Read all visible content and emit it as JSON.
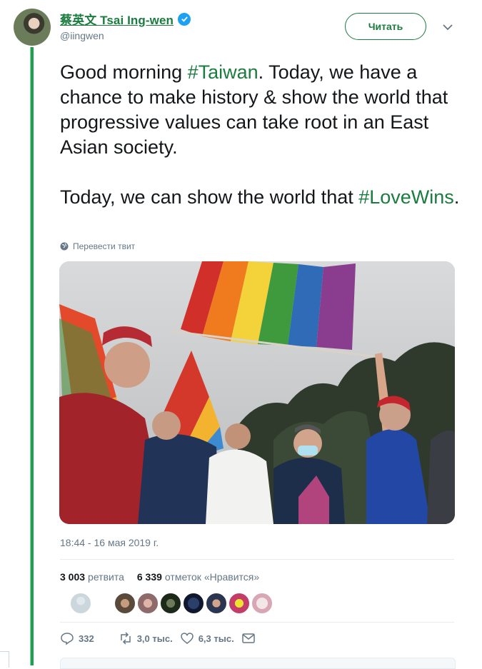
{
  "user": {
    "display_name": "蔡英文 Tsai Ing-wen",
    "handle": "@iingwen",
    "verified": true
  },
  "follow_label": "Читать",
  "tweet": {
    "paragraph1_before": "Good morning ",
    "paragraph1_hashtag": "#Taiwan",
    "paragraph1_after": ". Today, we have a chance to make history & show the world that progressive values can take root in an East Asian society.",
    "paragraph2_before": "Today, we can show the world that ",
    "paragraph2_hashtag": "#LoveWins",
    "paragraph2_after": "."
  },
  "translate_label": "Перевести твит",
  "timestamp": "18:44 - 16 мая 2019 г.",
  "stats": {
    "retweets_count": "3 003",
    "retweets_label": "ретвита",
    "likes_count": "6 339",
    "likes_label": "отметок «Нравится»"
  },
  "actions": {
    "replies": "332",
    "retweets": "3,0 тыс.",
    "likes": "6,3 тыс."
  },
  "colors": {
    "accent": "#1b7c3f",
    "muted": "#657786",
    "verified": "#1da1f2"
  }
}
